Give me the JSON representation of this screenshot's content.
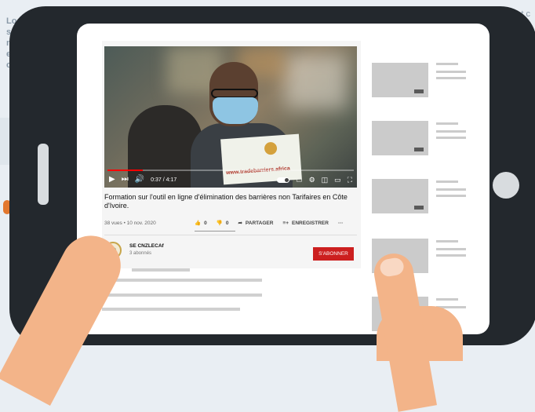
{
  "background": {
    "left_text_lines": [
      "Lo",
      "s",
      "n",
      "e",
      "c"
    ],
    "right_text": "t c"
  },
  "video": {
    "current_time": "0:37",
    "duration": "4:17",
    "time_display": "0:37 / 4:17",
    "progress_fraction": 0.144,
    "paper_url": "www.tradebarriers.africa"
  },
  "details": {
    "title": "Formation sur l'outil en ligne d'élimination des barrières non Tarifaires en Côte d'Ivoire.",
    "meta": "38 vues • 10 nov. 2020",
    "likes": "0",
    "dislikes": "0",
    "share_label": "PARTAGER",
    "save_label": "ENREGISTRER",
    "more_label": "···"
  },
  "channel": {
    "name": "SE CNZLECAf",
    "subscribers": "3 abonnés",
    "subscribe_label": "S'ABONNER"
  },
  "colors": {
    "subscribe": "#cc1f1f",
    "tablet_frame": "#23282d",
    "progress": "#ff0000"
  }
}
